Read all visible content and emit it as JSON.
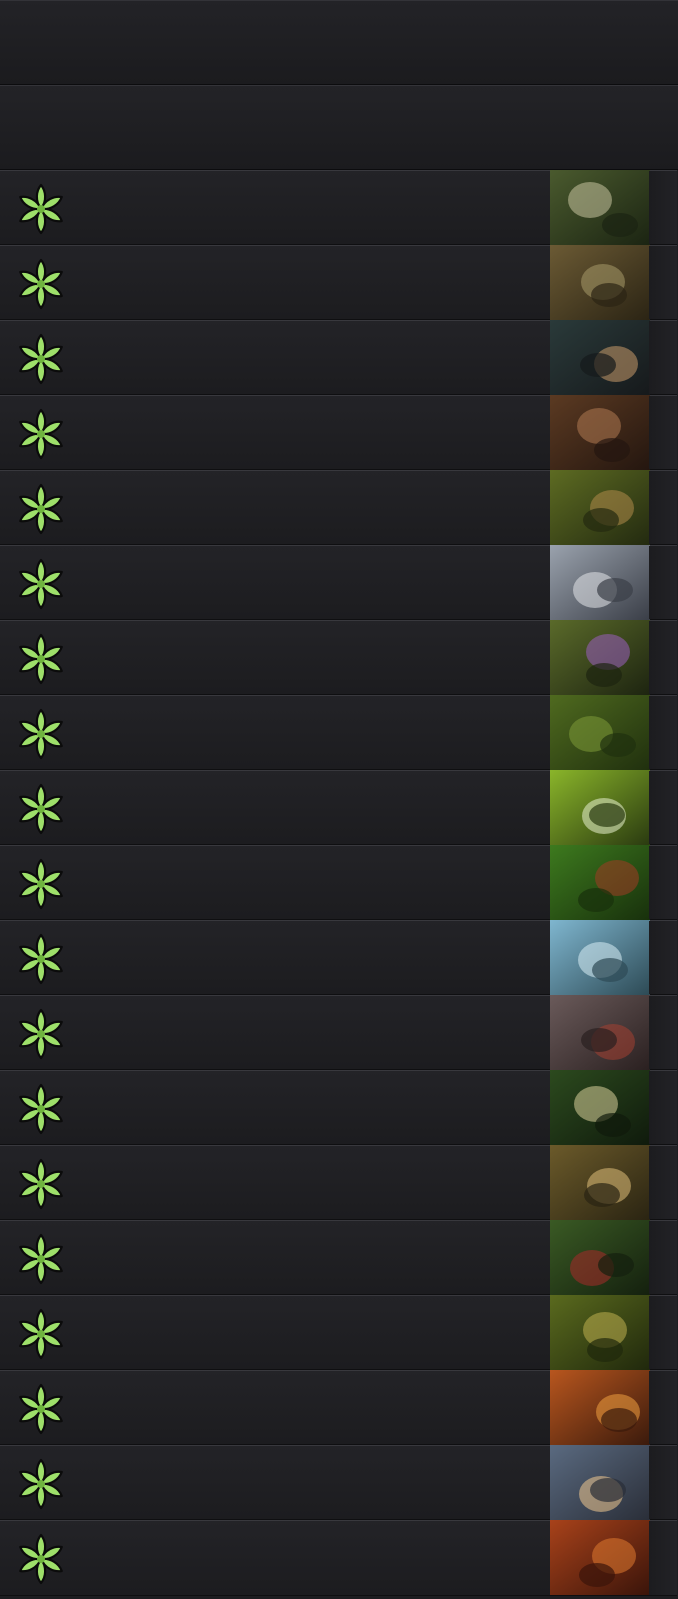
{
  "header": {
    "title": "",
    "subtitle": ""
  },
  "colors": {
    "background": "#1d1d20",
    "row_top": "#232327",
    "row_bottom": "#1c1c1f",
    "row_border_light": "#38383d",
    "row_border_dark": "#0f0f11",
    "forest_symbol": "#9ee06a",
    "forest_symbol_outline": "#0b0b0b"
  },
  "rows": [
    {
      "name": "",
      "symbol": "forest-mana-icon",
      "art": {
        "c1": "#4a5a2e",
        "c2": "#1b2412",
        "accent": "#c9c4a0"
      }
    },
    {
      "name": "",
      "symbol": "forest-mana-icon",
      "art": {
        "c1": "#6b5a34",
        "c2": "#2b2414",
        "accent": "#a89a6a"
      }
    },
    {
      "name": "",
      "symbol": "forest-mana-icon",
      "art": {
        "c1": "#2a3a3a",
        "c2": "#16191b",
        "accent": "#c89b6a"
      }
    },
    {
      "name": "",
      "symbol": "forest-mana-icon",
      "art": {
        "c1": "#5b3a22",
        "c2": "#24160f",
        "accent": "#b07a52"
      }
    },
    {
      "name": "",
      "symbol": "forest-mana-icon",
      "art": {
        "c1": "#5d6b22",
        "c2": "#232a10",
        "accent": "#b08a4a"
      }
    },
    {
      "name": "",
      "symbol": "forest-mana-icon",
      "art": {
        "c1": "#9aa2ad",
        "c2": "#3a3e47",
        "accent": "#e4e6ea"
      }
    },
    {
      "name": "",
      "symbol": "forest-mana-icon",
      "art": {
        "c1": "#5a6a2a",
        "c2": "#1d2410",
        "accent": "#9b5fc0"
      }
    },
    {
      "name": "",
      "symbol": "forest-mana-icon",
      "art": {
        "c1": "#4f6a1f",
        "c2": "#20300e",
        "accent": "#7d9a38"
      }
    },
    {
      "name": "",
      "symbol": "forest-mana-icon",
      "art": {
        "c1": "#8ab52a",
        "c2": "#2a3a10",
        "accent": "#e8f0d0"
      }
    },
    {
      "name": "",
      "symbol": "forest-mana-icon",
      "art": {
        "c1": "#3d7a1e",
        "c2": "#18300c",
        "accent": "#a23a24"
      }
    },
    {
      "name": "",
      "symbol": "forest-mana-icon",
      "art": {
        "c1": "#7fb6cf",
        "c2": "#2d4a55",
        "accent": "#d9eef6"
      }
    },
    {
      "name": "",
      "symbol": "forest-mana-icon",
      "art": {
        "c1": "#6a5a5a",
        "c2": "#2a2020",
        "accent": "#a44032"
      }
    },
    {
      "name": "",
      "symbol": "forest-mana-icon",
      "art": {
        "c1": "#2c4a1e",
        "c2": "#0f1a0c",
        "accent": "#d8d09a"
      }
    },
    {
      "name": "",
      "symbol": "forest-mana-icon",
      "art": {
        "c1": "#6b5a2a",
        "c2": "#2a2412",
        "accent": "#e0c07a"
      }
    },
    {
      "name": "",
      "symbol": "forest-mana-icon",
      "art": {
        "c1": "#3a5a24",
        "c2": "#14200e",
        "accent": "#a82a2a"
      }
    },
    {
      "name": "",
      "symbol": "forest-mana-icon",
      "art": {
        "c1": "#5a6a1e",
        "c2": "#20280c",
        "accent": "#c0b050"
      }
    },
    {
      "name": "",
      "symbol": "forest-mana-icon",
      "art": {
        "c1": "#b8561e",
        "c2": "#3a1a0c",
        "accent": "#f0a040"
      }
    },
    {
      "name": "",
      "symbol": "forest-mana-icon",
      "art": {
        "c1": "#5a6a80",
        "c2": "#2a2e38",
        "accent": "#f0c890"
      }
    },
    {
      "name": "",
      "symbol": "forest-mana-icon",
      "art": {
        "c1": "#a8421a",
        "c2": "#3a140a",
        "accent": "#e07a30"
      }
    }
  ]
}
